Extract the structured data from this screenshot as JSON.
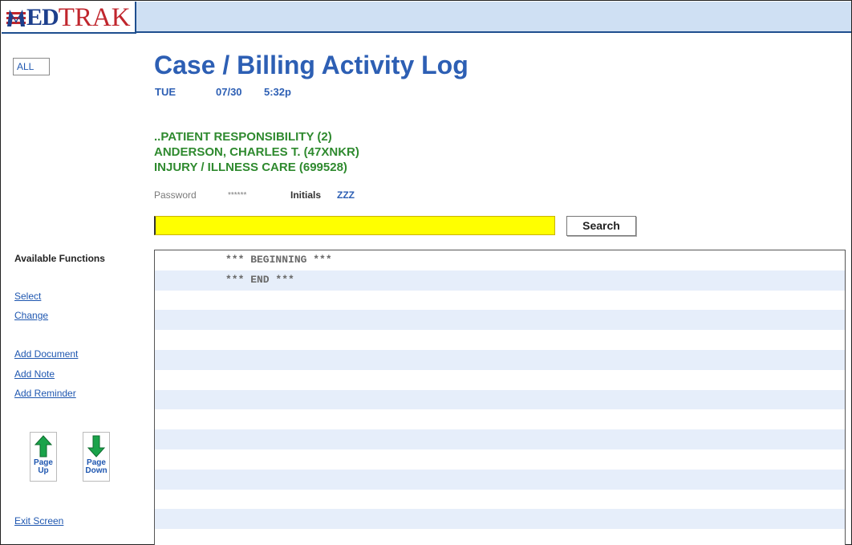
{
  "app": {
    "logo_prefix": "ED",
    "logo_name": "TRAK"
  },
  "filter": {
    "all_label": "ALL"
  },
  "header": {
    "title": "Case / Billing Activity Log",
    "day": "TUE",
    "date": "07/30",
    "time": "5:32p"
  },
  "case": {
    "line1": "..PATIENT RESPONSIBILITY (2)",
    "line2": "ANDERSON, CHARLES T. (47XNKR)",
    "line3": "INJURY / ILLNESS CARE (699528)"
  },
  "auth": {
    "password_label": "Password",
    "password_value": "******",
    "initials_label": "Initials",
    "initials_value": "ZZZ"
  },
  "search": {
    "value": "",
    "button_label": "Search"
  },
  "sidebar": {
    "heading": "Available Functions",
    "links": {
      "select": "Select",
      "change": "Change",
      "add_document": "Add Document",
      "add_note": "Add Note",
      "add_reminder": "Add Reminder",
      "exit": "Exit Screen"
    },
    "page_up": {
      "line1": "Page",
      "line2": "Up",
      "icon": "arrow-up-icon",
      "color": "#1aa34a"
    },
    "page_down": {
      "line1": "Page",
      "line2": "Down",
      "icon": "arrow-down-icon",
      "color": "#1aa34a"
    }
  },
  "log": {
    "rows": [
      "*** BEGINNING ***",
      "*** END ***",
      "",
      "",
      "",
      "",
      "",
      "",
      "",
      "",
      "",
      "",
      "",
      "",
      ""
    ]
  },
  "colors": {
    "accent_blue": "#2d5fb4",
    "case_green": "#2f8a2f",
    "input_yellow": "#ffff00",
    "row_stripe": "#e6eefa"
  }
}
